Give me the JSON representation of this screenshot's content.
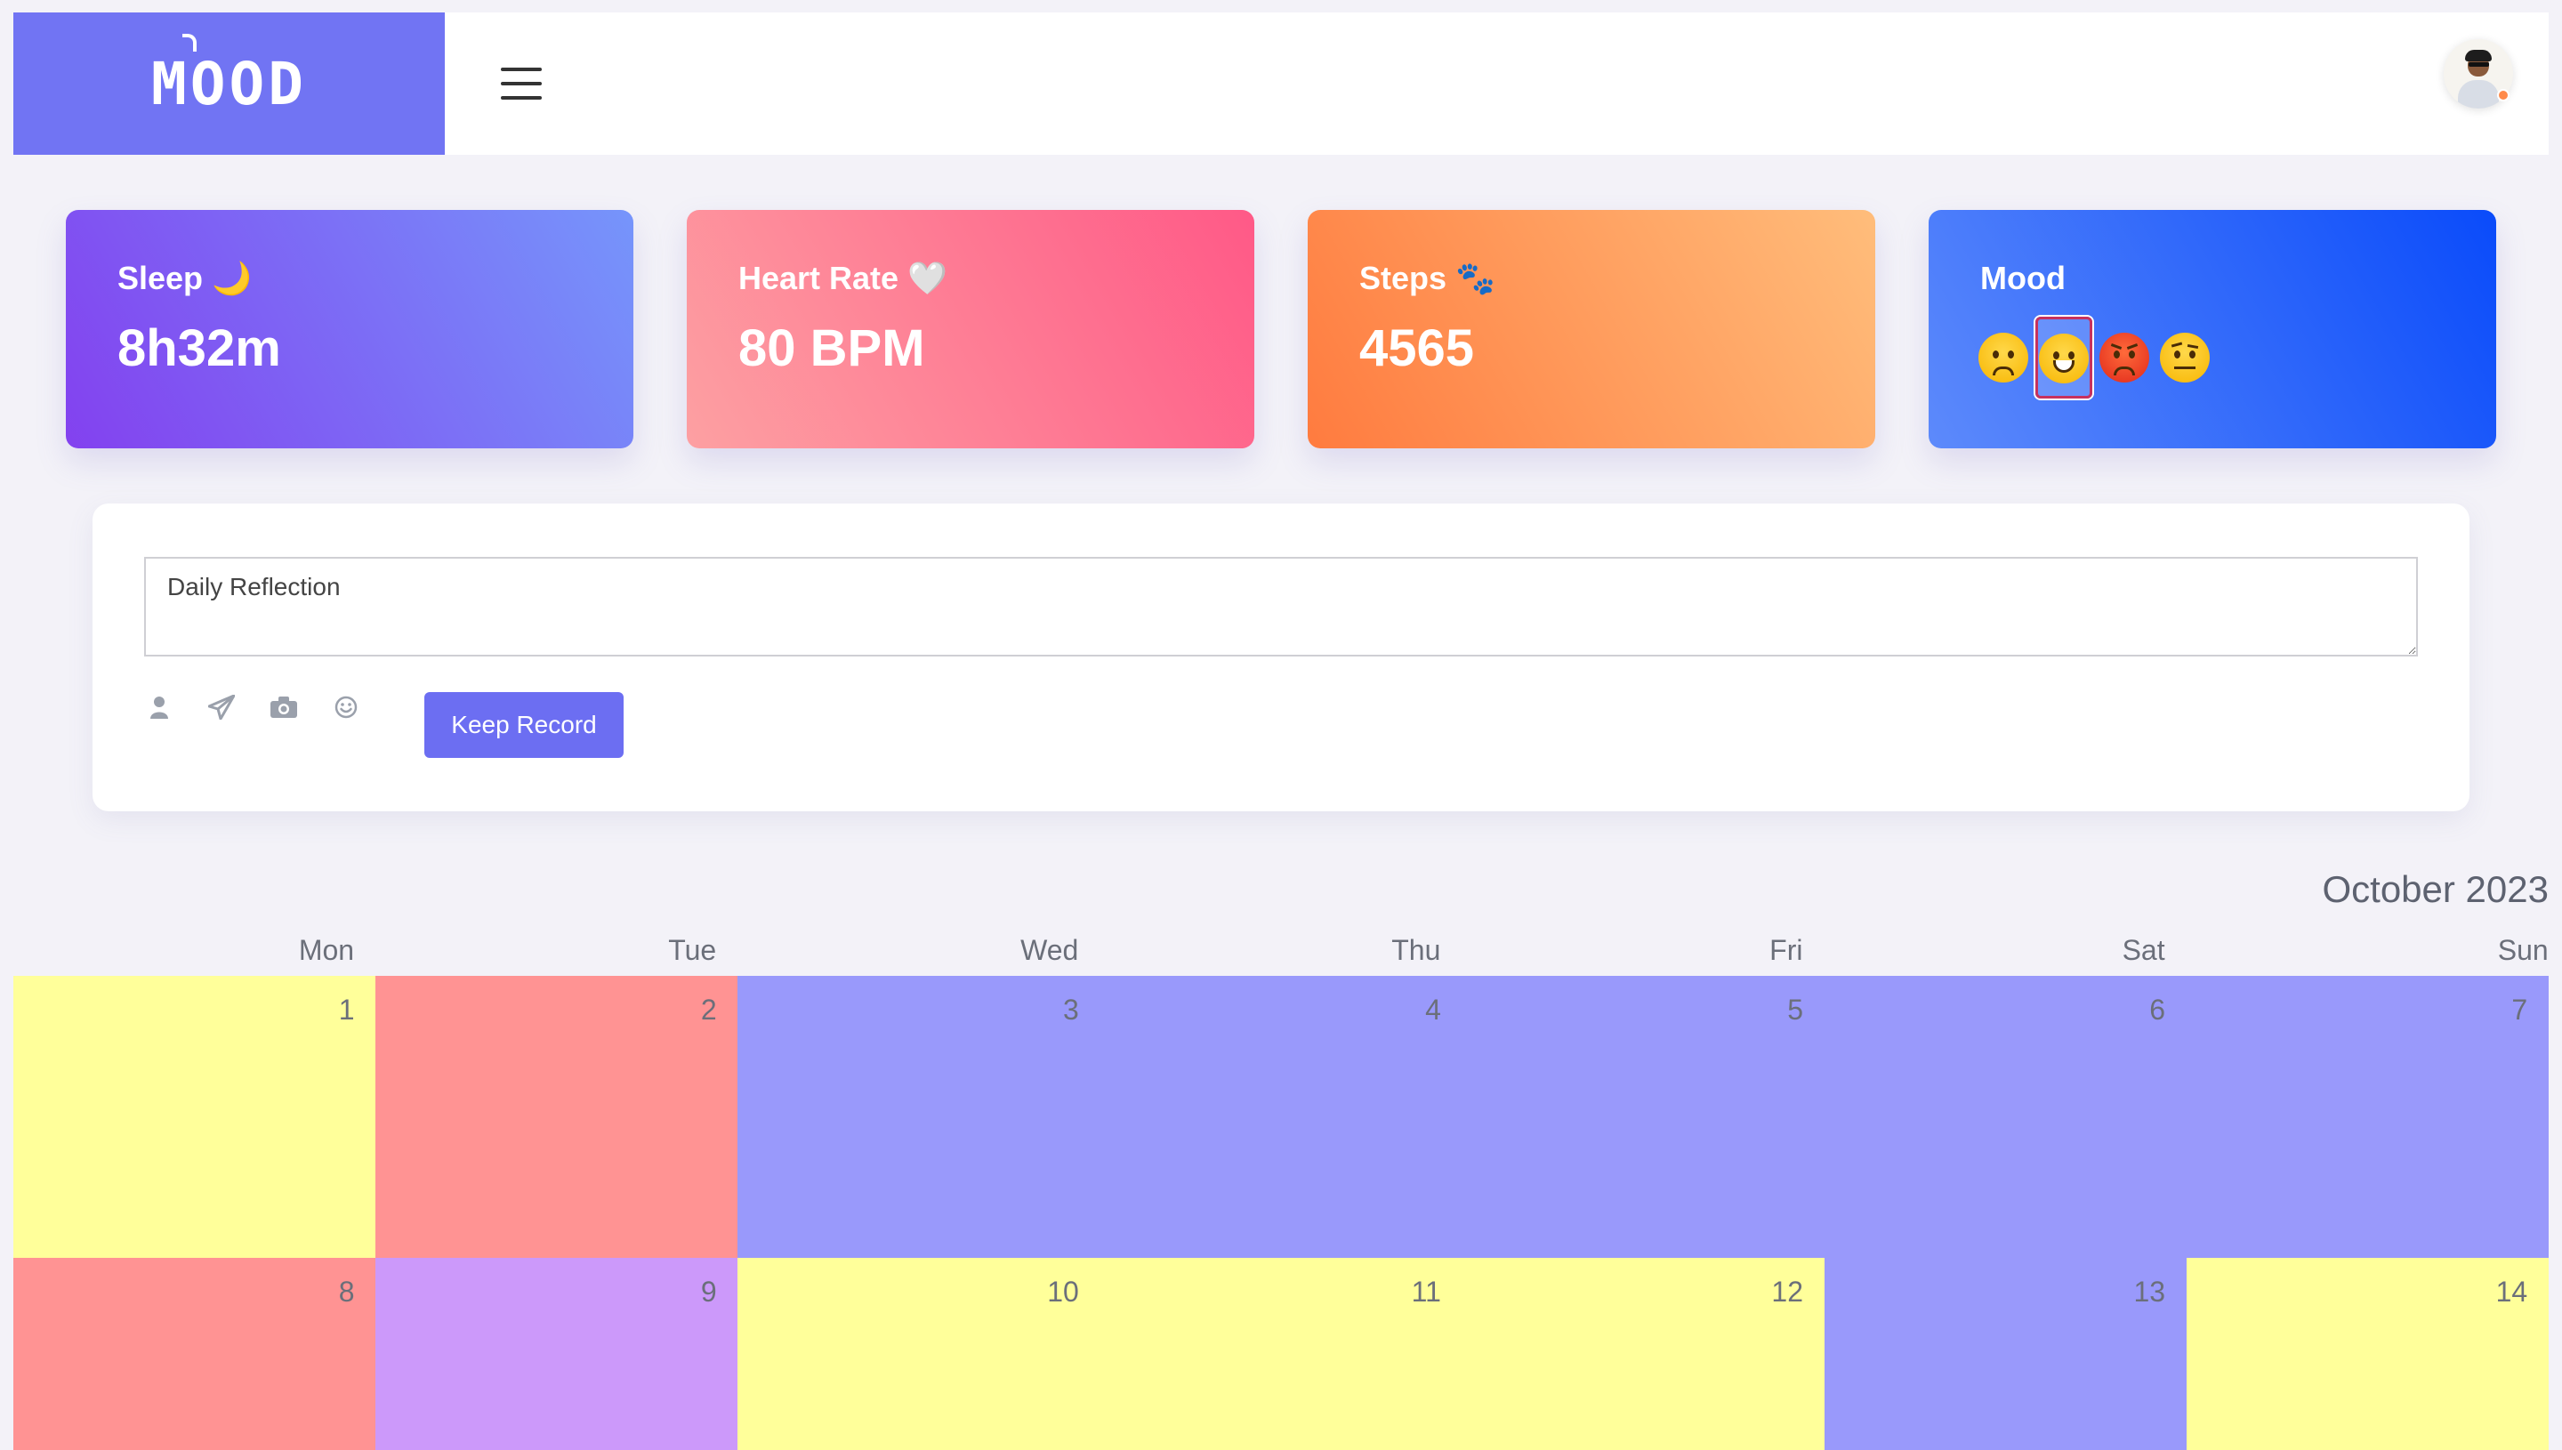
{
  "header": {
    "logo": "MOOD",
    "menu_icon": "hamburger-menu-icon",
    "avatar_icon": "user-avatar-icon",
    "status_color": "#ff8a4a"
  },
  "stats": {
    "sleep": {
      "label": "Sleep 🌙",
      "value": "8h32m"
    },
    "heart": {
      "label": "Heart Rate 🤍",
      "value": "80 BPM"
    },
    "steps": {
      "label": "Steps 🐾",
      "value": "4565"
    },
    "mood": {
      "label": "Mood",
      "options": [
        "sad",
        "grinning",
        "angry",
        "raised-eyebrow"
      ],
      "selected": "grinning"
    }
  },
  "reflection": {
    "placeholder": "Daily Reflection",
    "tools": [
      "user-icon",
      "send-icon",
      "camera-icon",
      "smiley-icon"
    ],
    "submit_label": "Keep Record"
  },
  "calendar": {
    "title": "October 2023",
    "weekdays": [
      "Mon",
      "Tue",
      "Wed",
      "Thu",
      "Fri",
      "Sat",
      "Sun"
    ],
    "mood_colors": {
      "happy": "#ffff9a",
      "angry": "#ff9393",
      "calm": "#9999fb",
      "excited": "#cc99fa"
    },
    "days": [
      {
        "day": "1",
        "mood": "happy"
      },
      {
        "day": "2",
        "mood": "angry"
      },
      {
        "day": "3",
        "mood": "calm"
      },
      {
        "day": "4",
        "mood": "calm"
      },
      {
        "day": "5",
        "mood": "calm"
      },
      {
        "day": "6",
        "mood": "calm"
      },
      {
        "day": "7",
        "mood": "calm"
      },
      {
        "day": "8",
        "mood": "angry"
      },
      {
        "day": "9",
        "mood": "excited"
      },
      {
        "day": "10",
        "mood": "happy"
      },
      {
        "day": "11",
        "mood": "happy"
      },
      {
        "day": "12",
        "mood": "happy"
      },
      {
        "day": "13",
        "mood": "calm"
      },
      {
        "day": "14",
        "mood": "happy"
      }
    ]
  }
}
